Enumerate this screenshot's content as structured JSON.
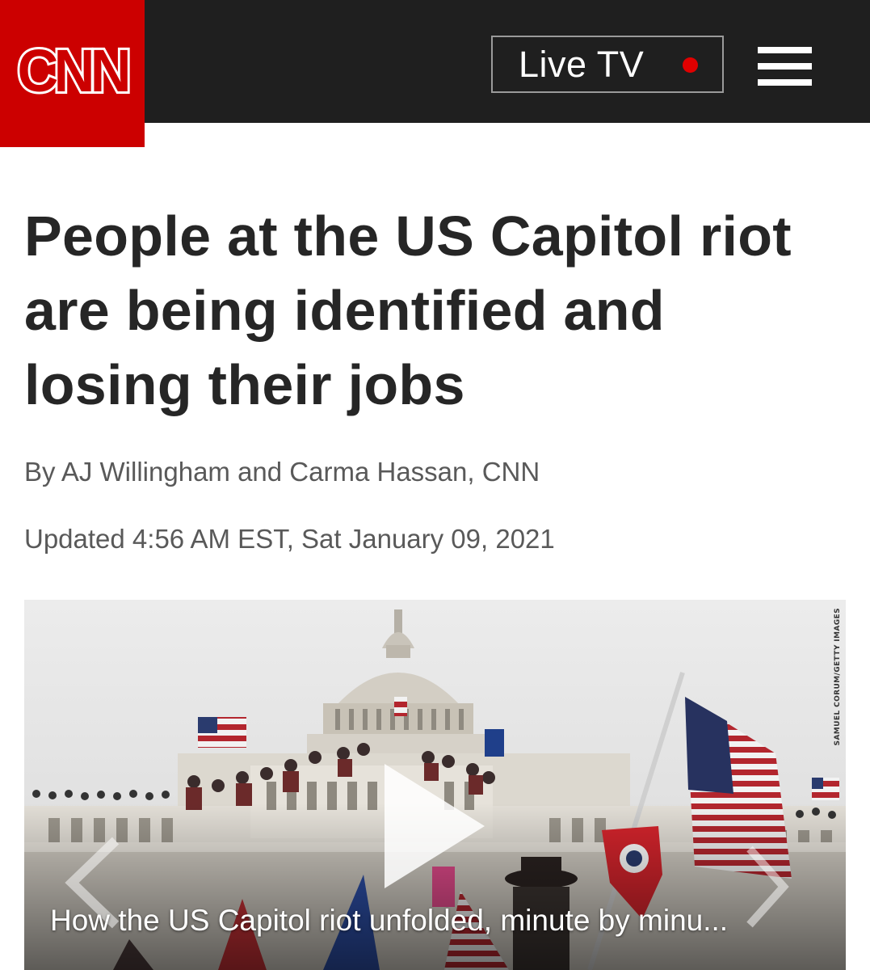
{
  "header": {
    "logo_text": "CNN",
    "live_label": "Live TV",
    "brand_red": "#cc0000",
    "bar_color": "#1f1f1f",
    "menu_icon": "hamburger-menu-icon"
  },
  "article": {
    "headline": "People at the US Capitol riot are being identified and losing their jobs",
    "byline": "By AJ Willingham and Carma Hassan, CNN",
    "updated": "Updated 4:56 AM EST, Sat January 09, 2021"
  },
  "media": {
    "photo_credit": "SAMUEL CORUM/GETTY IMAGES",
    "caption": "How the US Capitol riot unfolded, minute by minu...",
    "play_icon": "play-icon",
    "prev_icon": "chevron-left-icon",
    "next_icon": "chevron-right-icon"
  }
}
